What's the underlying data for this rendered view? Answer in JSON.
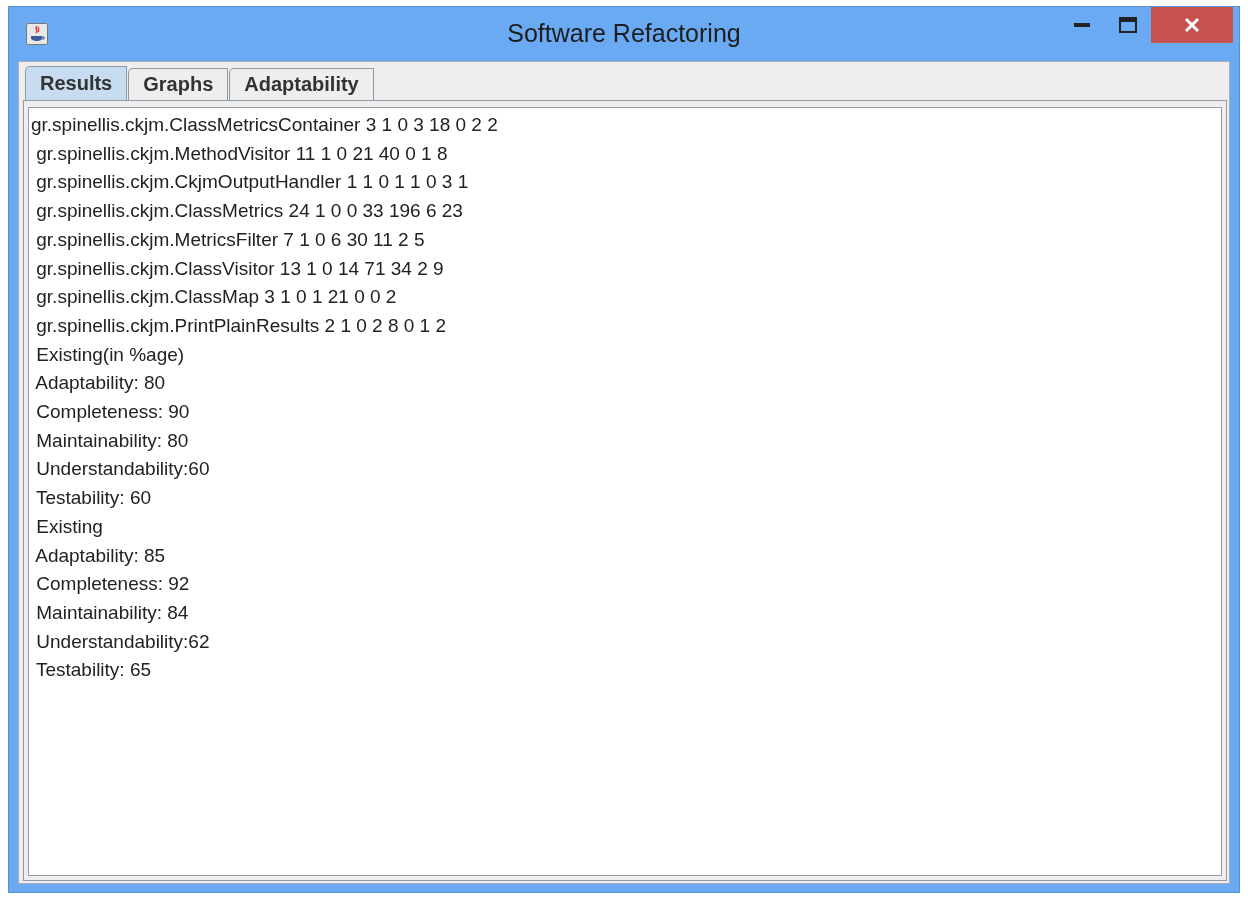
{
  "window": {
    "title": "Software Refactoring"
  },
  "tabs": [
    {
      "label": "Results",
      "selected": true
    },
    {
      "label": "Graphs",
      "selected": false
    },
    {
      "label": "Adaptability",
      "selected": false
    }
  ],
  "results_text": {
    "lines": [
      "gr.spinellis.ckjm.ClassMetricsContainer 3 1 0 3 18 0 2 2",
      " gr.spinellis.ckjm.MethodVisitor 11 1 0 21 40 0 1 8",
      " gr.spinellis.ckjm.CkjmOutputHandler 1 1 0 1 1 0 3 1",
      " gr.spinellis.ckjm.ClassMetrics 24 1 0 0 33 196 6 23",
      " gr.spinellis.ckjm.MetricsFilter 7 1 0 6 30 11 2 5",
      " gr.spinellis.ckjm.ClassVisitor 13 1 0 14 71 34 2 9",
      " gr.spinellis.ckjm.ClassMap 3 1 0 1 21 0 0 2",
      " gr.spinellis.ckjm.PrintPlainResults 2 1 0 2 8 0 1 2",
      " Existing(in %age)",
      " Adaptability: 80",
      " Completeness: 90",
      " Maintainability: 80",
      " Understandability:60",
      " Testability: 60",
      " Existing",
      " Adaptability: 85",
      " Completeness: 92",
      " Maintainability: 84",
      " Understandability:62",
      " Testability: 65"
    ]
  }
}
